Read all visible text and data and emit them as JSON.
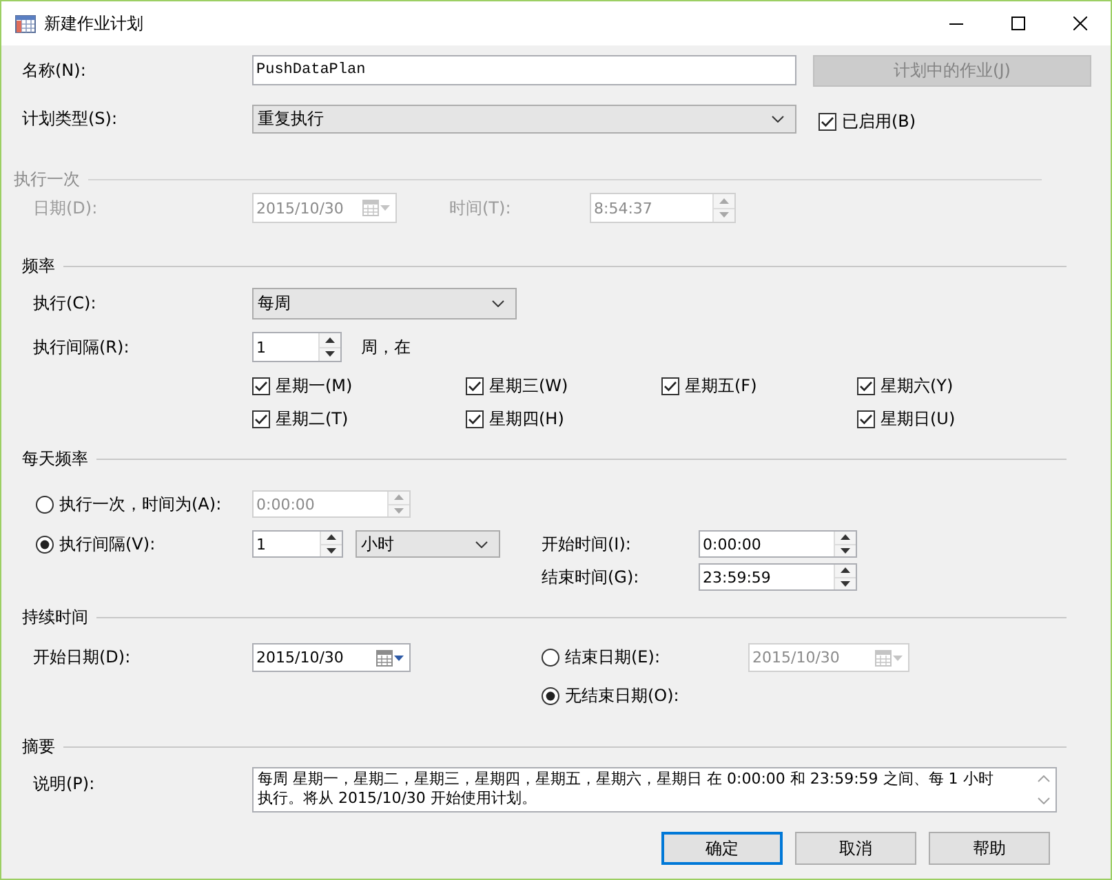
{
  "window": {
    "title": "新建作业计划"
  },
  "name_row": {
    "label": "名称(N):",
    "value": "PushDataPlan",
    "jobs_button": {
      "label": "计划中的作业(J)",
      "disabled": true
    }
  },
  "schedule_type": {
    "label": "计划类型(S):",
    "value": "重复执行",
    "enabled_checkbox": {
      "label": "已启用(B)",
      "checked": true
    }
  },
  "one_time": {
    "title": "执行一次",
    "disabled": true,
    "date_label": "日期(D):",
    "date": "2015/10/30",
    "time_label": "时间(T):",
    "time": "8:54:37"
  },
  "frequency": {
    "title": "频率",
    "occurs_label": "执行(C):",
    "occurs": "每周",
    "recur_label": "执行间隔(R):",
    "recur_value": "1",
    "recur_unit": "周，在",
    "weekday_columns": [
      [
        {
          "label": "星期一(M)",
          "checked": true
        },
        {
          "label": "星期二(T)",
          "checked": true
        }
      ],
      [
        {
          "label": "星期三(W)",
          "checked": true
        },
        {
          "label": "星期四(H)",
          "checked": true
        }
      ],
      [
        {
          "label": "星期五(F)",
          "checked": true
        }
      ],
      [
        {
          "label": "星期六(Y)",
          "checked": true
        },
        {
          "label": "星期日(U)",
          "checked": true
        }
      ]
    ]
  },
  "daily_frequency": {
    "title": "每天频率",
    "options": [
      {
        "kind": "once",
        "label": "执行一次，时间为(A):",
        "selected": false,
        "time": "0:00:00"
      },
      {
        "kind": "interval",
        "label": "执行间隔(V):",
        "selected": true,
        "value": "1",
        "unit": "小时",
        "start_label": "开始时间(I):",
        "start": "0:00:00",
        "end_label": "结束时间(G):",
        "end": "23:59:59"
      }
    ]
  },
  "duration": {
    "title": "持续时间",
    "start_label": "开始日期(D):",
    "start_date": "2015/10/30",
    "end_options": [
      {
        "kind": "end_date",
        "label": "结束日期(E):",
        "selected": false,
        "date": "2015/10/30"
      },
      {
        "kind": "no_end",
        "label": "无结束日期(O):",
        "selected": true
      }
    ]
  },
  "summary": {
    "title": "摘要",
    "description_label": "说明(P):",
    "description": "每周 星期一，星期二，星期三，星期四，星期五，星期六，星期日 在 0:00:00 和 23:59:59 之间、每 1 小时执行。将从 2015/10/30 开始使用计划。"
  },
  "buttons": [
    {
      "label": "确定",
      "default": true
    },
    {
      "label": "取消",
      "default": false
    },
    {
      "label": "帮助",
      "default": false
    }
  ]
}
